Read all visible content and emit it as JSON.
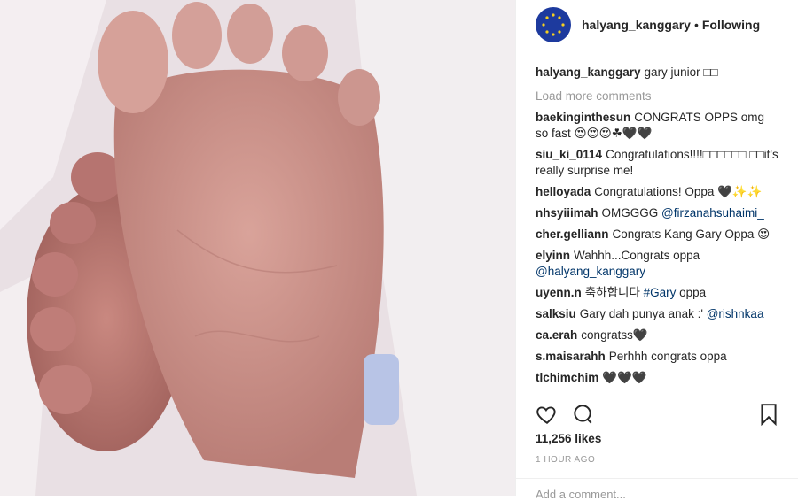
{
  "post": {
    "owner": "halyang_kanggary",
    "separator": "•",
    "follow_status": "Following",
    "caption_user": "halyang_kanggary",
    "caption_text": "gary junior □□"
  },
  "load_more": "Load more comments",
  "comments": [
    {
      "user": "baekinginthesun",
      "text": "CONGRATS OPPS omg so fast 😍😍😍☘🖤🖤"
    },
    {
      "user": "siu_ki_0114",
      "text": "Congratulations!!!!□□□□□□ □□it's really surprise me!"
    },
    {
      "user": "helloyada",
      "text": "Congratulations! Oppa 🖤✨✨"
    },
    {
      "user": "nhsyiiimah",
      "text": "OMGGGG",
      "mention": "@firzanahsuhaimi_"
    },
    {
      "user": "cher.gelliann",
      "text": "Congrats Kang Gary Oppa 😍"
    },
    {
      "user": "elyinn",
      "text": "Wahhh...Congrats oppa",
      "mention": "@halyang_kanggary"
    },
    {
      "user": "uyenn.n",
      "text": "축하합니다",
      "mention": "#Gary",
      "after": " oppa"
    },
    {
      "user": "salksiu",
      "text": "Gary dah punya anak :'",
      "mention": "@rishnkaa"
    },
    {
      "user": "ca.erah",
      "text": "congratss🖤"
    },
    {
      "user": "s.maisarahh",
      "text": "Perhhh congrats oppa"
    },
    {
      "user": "tlchimchim",
      "text": "🖤🖤🖤"
    }
  ],
  "likes": "11,256 likes",
  "time": "1 HOUR AGO",
  "add_comment_placeholder": "Add a comment..."
}
